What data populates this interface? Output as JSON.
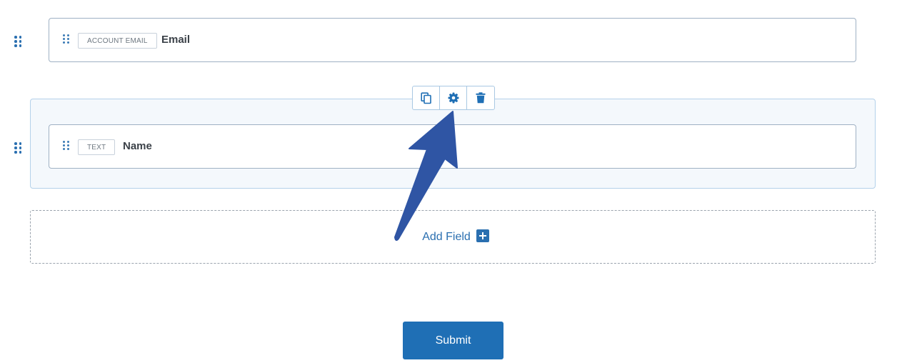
{
  "fields": [
    {
      "type_badge": "ACCOUNT EMAIL",
      "label": "Email"
    },
    {
      "type_badge": "TEXT",
      "label": "Name"
    }
  ],
  "toolbar": {
    "duplicate_icon": "copy-icon",
    "settings_icon": "gear-icon",
    "delete_icon": "trash-icon"
  },
  "add_field": {
    "label": "Add Field",
    "icon": "plus-square-icon"
  },
  "submit": {
    "label": "Submit"
  },
  "colors": {
    "accent": "#1f6fb5",
    "arrow": "#2f55a4",
    "selected_bg": "#f4f8fc"
  }
}
